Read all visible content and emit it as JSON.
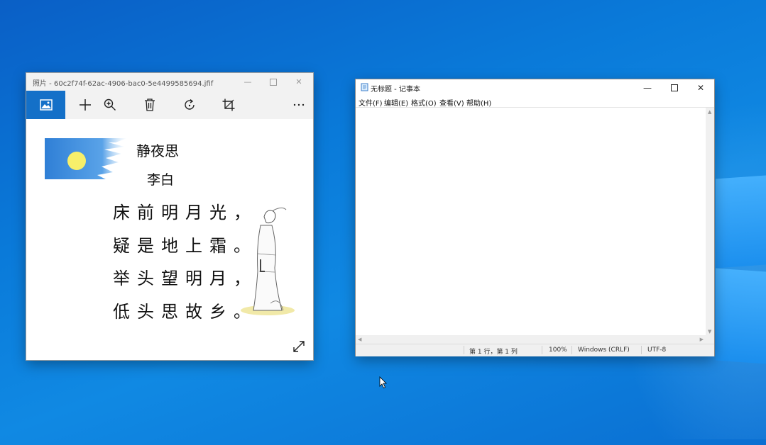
{
  "photos": {
    "title": "照片 - 60c2f74f-62ac-4906-bac0-5e4499585694.jfif",
    "poem": {
      "title": "静夜思",
      "author": "李白",
      "lines": [
        "床前明月光，",
        "疑是地上霜。",
        "举头望明月，",
        "低头思故乡。"
      ]
    },
    "icons": {
      "image": "image-icon",
      "add": "plus-icon",
      "zoom": "zoom-in-icon",
      "delete": "trash-icon",
      "rotate": "rotate-icon",
      "crop": "crop-icon",
      "more": "ellipsis-icon",
      "expand": "expand-icon"
    },
    "colors": {
      "accent": "#1470c8"
    }
  },
  "notepad": {
    "title": "无标题 - 记事本",
    "menu": [
      "文件(F)",
      "编辑(E)",
      "格式(O)",
      "查看(V)",
      "帮助(H)"
    ],
    "content": "",
    "status": {
      "position": "第 1 行，第 1 列",
      "zoom": "100%",
      "line_ending": "Windows (CRLF)",
      "encoding": "UTF-8"
    }
  },
  "desktop": {
    "background": "#0a78d8"
  }
}
